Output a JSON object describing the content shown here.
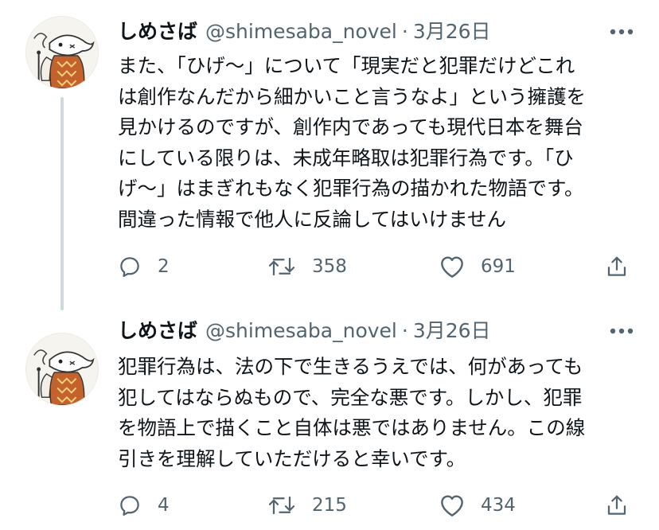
{
  "tweets": [
    {
      "author": {
        "name": "しめさば",
        "handle": "@shimesaba_novel",
        "avatar": "fish-character-avatar"
      },
      "separator": "·",
      "date": "3月26日",
      "lines": [
        "また、「ひげ〜」について「現実だと犯罪だけどこれ",
        "は創作なんだから細かいこと言うなよ」という擁護を",
        "見かけるのですが、創作内であっても現代日本を舞台",
        "にしている限りは、未成年略取は犯罪行為です。「ひ",
        "げ〜」はまぎれもなく犯罪行為の描かれた物語です。",
        "間違った情報で他人に反論してはいけません"
      ],
      "actions": {
        "replies": "2",
        "retweets": "358",
        "likes": "691"
      },
      "more_icon": "more-dots-icon"
    },
    {
      "author": {
        "name": "しめさば",
        "handle": "@shimesaba_novel",
        "avatar": "fish-character-avatar"
      },
      "separator": "·",
      "date": "3月26日",
      "lines": [
        "犯罪行為は、法の下で生きるうえでは、何があっても",
        "犯してはならぬもので、完全な悪です。しかし、犯罪",
        "を物語上で描くこと自体は悪ではありません。この線",
        "引きを理解していただけると幸いです。"
      ],
      "actions": {
        "replies": "4",
        "retweets": "215",
        "likes": "434"
      },
      "more_icon": "more-dots-icon"
    }
  ],
  "colors": {
    "text": "#0f1419",
    "secondary": "#536471",
    "thread_line": "#cfd9de",
    "background": "#ffffff"
  }
}
